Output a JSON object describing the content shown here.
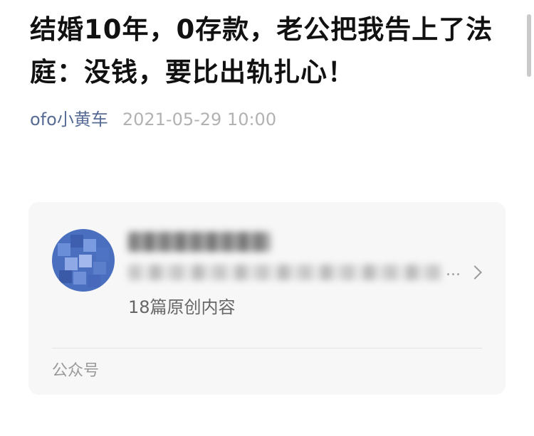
{
  "article": {
    "title": "结婚10年，0存款，老公把我告上了法庭：没钱，要比出轨扎心！",
    "author": "ofo小黄车",
    "date": "2021-05-29 10:00"
  },
  "account_card": {
    "original_count": "18篇原创内容",
    "footer_label": "公众号",
    "ellipsis": "...",
    "avatar_color": "#4a6fbf"
  }
}
